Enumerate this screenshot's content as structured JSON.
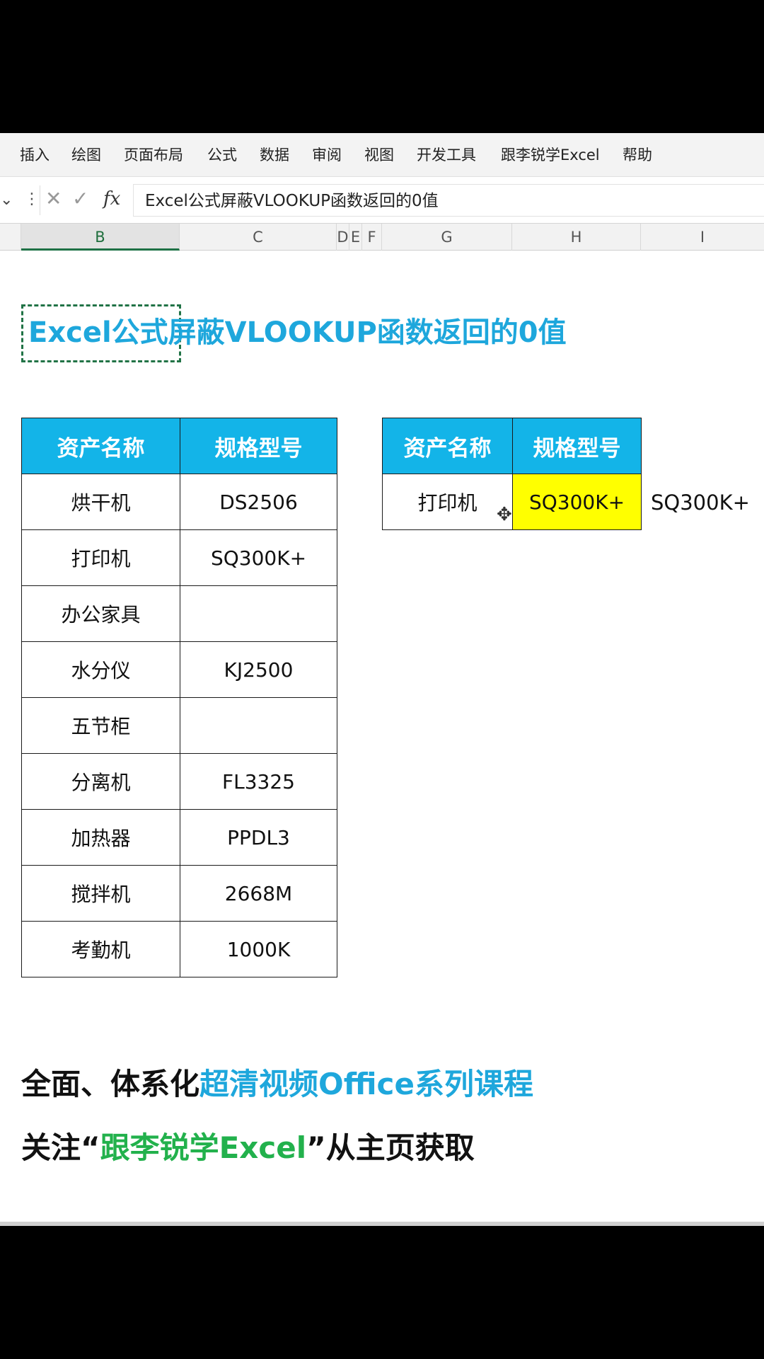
{
  "ribbon": {
    "tabs": [
      "插入",
      "绘图",
      "页面布局",
      "公式",
      "数据",
      "审阅",
      "视图",
      "开发工具",
      "跟李锐学Excel",
      "帮助"
    ]
  },
  "formula_bar": {
    "name_box_icon": "chevron-down-icon",
    "cancel_icon": "close-icon",
    "enter_icon": "check-icon",
    "fx_label": "fx",
    "formula_text": "Excel公式屏蔽VLOOKUP函数返回的0值"
  },
  "columns": {
    "b": "B",
    "c": "C",
    "d": "D",
    "e": "E",
    "f": "F",
    "g": "G",
    "h": "H",
    "i": "I"
  },
  "sheet": {
    "title": "Excel公式屏蔽VLOOKUP函数返回的0值",
    "main_table": {
      "headers": [
        "资产名称",
        "规格型号"
      ],
      "rows": [
        [
          "烘干机",
          "DS2506"
        ],
        [
          "打印机",
          "SQ300K+"
        ],
        [
          "办公家具",
          ""
        ],
        [
          "水分仪",
          "KJ2500"
        ],
        [
          "五节柜",
          ""
        ],
        [
          "分离机",
          "FL3325"
        ],
        [
          "加热器",
          "PPDL3"
        ],
        [
          "搅拌机",
          "2668M"
        ],
        [
          "考勤机",
          "1000K"
        ]
      ]
    },
    "lookup_table": {
      "headers": [
        "资产名称",
        "规格型号"
      ],
      "query": "打印机",
      "result": "SQ300K+",
      "result_fill": "#ffff00"
    },
    "outside_value": "SQ300K+",
    "promo": {
      "line1_prefix": "全面、体系化",
      "line1_highlight": "超清视频Office系列课程",
      "line2_prefix": "关注“",
      "line2_highlight": "跟李锐学Excel",
      "line2_suffix": "”从主页获取"
    }
  },
  "colors": {
    "header_fill": "#13b4e8",
    "title": "#1ea7dc",
    "promo_green": "#22b14c",
    "selection": "#217346"
  }
}
